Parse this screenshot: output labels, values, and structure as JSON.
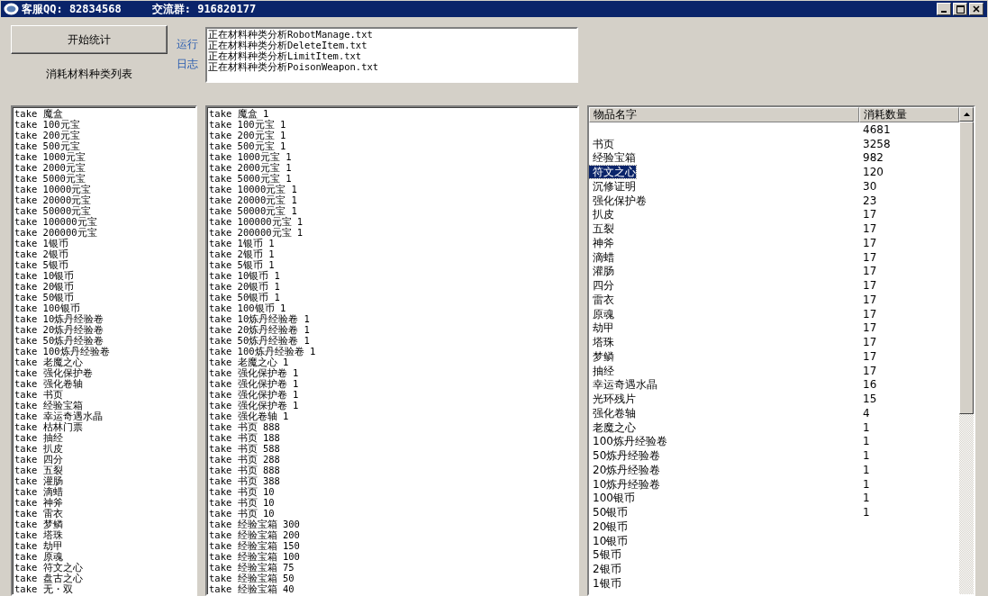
{
  "window": {
    "title_parts": [
      "客服QQ: 82834568",
      "交流群: 916820177"
    ]
  },
  "start_button": "开始统计",
  "list_caption": "消耗材料种类列表",
  "log_label": "运行日志",
  "log_lines": [
    "正在材料种类分析RobotManage.txt",
    "正在材料种类分析DeleteItem.txt",
    "正在材料种类分析LimitItem.txt",
    "正在材料种类分析PoisonWeapon.txt"
  ],
  "material_list": [
    "take 魔盒",
    "take 100元宝",
    "take 200元宝",
    "take 500元宝",
    "take 1000元宝",
    "take 2000元宝",
    "take 5000元宝",
    "take 10000元宝",
    "take 20000元宝",
    "take 50000元宝",
    "take 100000元宝",
    "take 200000元宝",
    "take 1银币",
    "take 2银币",
    "take 5银币",
    "take 10银币",
    "take 20银币",
    "take 50银币",
    "take 100银币",
    "take 10炼丹经验卷",
    "take 20炼丹经验卷",
    "take 50炼丹经验卷",
    "take 100炼丹经验卷",
    "take 老魔之心",
    "take 强化保护卷",
    "take 强化卷轴",
    "take 书页",
    "take 经验宝箱",
    "take 幸运奇遇水晶",
    "take 枯林门票",
    "take 抽经",
    "take 扒皮",
    "take 四分",
    "take 五裂",
    "take 灌肠",
    "take 滴蜡",
    "take 神斧",
    "take 雷衣",
    "take 梦鳞",
    "take 塔珠",
    "take 劫甲",
    "take 原魂",
    "take 符文之心",
    "take 盘古之心",
    "take 无・双"
  ],
  "take_list": [
    "take 魔盒 1",
    "take 100元宝 1",
    "take 200元宝 1",
    "take 500元宝 1",
    "take 1000元宝 1",
    "take 2000元宝 1",
    "take 5000元宝 1",
    "take 10000元宝 1",
    "take 20000元宝 1",
    "take 50000元宝 1",
    "take 100000元宝 1",
    "take 200000元宝 1",
    "take 1银币 1",
    "take 2银币 1",
    "take 5银币 1",
    "take 10银币 1",
    "take 20银币 1",
    "take 50银币 1",
    "take 100银币 1",
    "take 10炼丹经验卷 1",
    "take 20炼丹经验卷 1",
    "take 50炼丹经验卷 1",
    "take 100炼丹经验卷 1",
    "take 老魔之心 1",
    "take 强化保护卷 1",
    "take 强化保护卷 1",
    "take 强化保护卷 1",
    "take 强化保护卷 1",
    "take 强化卷轴 1",
    "take 书页 888",
    "take 书页 188",
    "take 书页 588",
    "take 书页 288",
    "take 书页 888",
    "take 书页 388",
    "take 书页 10",
    "take 书页 10",
    "take 书页 10",
    "take 经验宝箱 300",
    "take 经验宝箱 200",
    "take 经验宝箱 150",
    "take 经验宝箱 100",
    "take 经验宝箱 75",
    "take 经验宝箱 50",
    "take 经验宝箱 40"
  ],
  "table": {
    "columns": [
      "物品名字",
      "消耗数量"
    ],
    "rows": [
      {
        "count": "4681",
        "selected": false
      },
      {
        "name": "书页",
        "count": "3258",
        "selected": false
      },
      {
        "name": "经验宝箱",
        "count": "982",
        "selected": false
      },
      {
        "name": "符文之心",
        "count": "120",
        "selected": true
      },
      {
        "name": "沉修证明",
        "count": "30",
        "selected": false
      },
      {
        "name": "强化保护卷",
        "count": "23",
        "selected": false
      },
      {
        "name": "扒皮",
        "count": "17",
        "selected": false
      },
      {
        "name": "五裂",
        "count": "17",
        "selected": false
      },
      {
        "name": "神斧",
        "count": "17",
        "selected": false
      },
      {
        "name": "滴蜡",
        "count": "17",
        "selected": false
      },
      {
        "name": "灌肠",
        "count": "17",
        "selected": false
      },
      {
        "name": "四分",
        "count": "17",
        "selected": false
      },
      {
        "name": "雷衣",
        "count": "17",
        "selected": false
      },
      {
        "name": "原魂",
        "count": "17",
        "selected": false
      },
      {
        "name": "劫甲",
        "count": "17",
        "selected": false
      },
      {
        "name": "塔珠",
        "count": "17",
        "selected": false
      },
      {
        "name": "梦鳞",
        "count": "17",
        "selected": false
      },
      {
        "name": "抽经",
        "count": "17",
        "selected": false
      },
      {
        "name": "幸运奇遇水晶",
        "count": "16",
        "selected": false
      },
      {
        "name": "光环残片",
        "count": "15",
        "selected": false
      },
      {
        "name": "强化卷轴",
        "count": "4",
        "selected": false
      },
      {
        "name": "老魔之心",
        "count": "1",
        "selected": false
      },
      {
        "name": "100炼丹经验卷",
        "count": "1",
        "selected": false
      },
      {
        "name": "50炼丹经验卷",
        "count": "1",
        "selected": false
      },
      {
        "name": "20炼丹经验卷",
        "count": "1",
        "selected": false
      },
      {
        "name": "10炼丹经验卷",
        "count": "1",
        "selected": false
      },
      {
        "name": "100银币",
        "count": "1",
        "selected": false
      },
      {
        "name": "50银币",
        "count": "1",
        "selected": false
      },
      {
        "name": "20银币",
        "selected": false
      },
      {
        "name": "10银币",
        "selected": false
      },
      {
        "name": "5银币",
        "selected": false
      },
      {
        "name": "2银币",
        "selected": false
      },
      {
        "name": "1银币",
        "selected": false
      }
    ]
  }
}
